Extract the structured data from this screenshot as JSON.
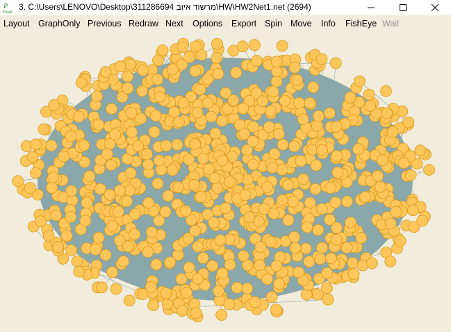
{
  "window": {
    "title": "3. C:\\Users\\LENOVO\\Desktop\\311286694 מרשוד איוב\\HW\\HW2Net1.net (2694)",
    "icon_name": "pajek-app-icon",
    "controls": [
      "minimize-icon",
      "maximize-icon",
      "close-icon"
    ]
  },
  "menu": [
    {
      "label": "Layout",
      "enabled": true
    },
    {
      "label": "GraphOnly",
      "enabled": true
    },
    {
      "label": "Previous",
      "enabled": true
    },
    {
      "label": "Redraw",
      "enabled": true
    },
    {
      "label": "Next",
      "enabled": true
    },
    {
      "label": "Options",
      "enabled": true
    },
    {
      "label": "Export",
      "enabled": true
    },
    {
      "label": "Spin",
      "enabled": true
    },
    {
      "label": "Move",
      "enabled": true
    },
    {
      "label": "Info",
      "enabled": true
    },
    {
      "label": "FishEye",
      "enabled": true
    },
    {
      "label": "Wait",
      "enabled": false
    }
  ],
  "graph": {
    "vertex_count": 2694,
    "vertex_fill": "#fcc65a",
    "vertex_stroke": "#d99a1c",
    "edge_color": "#8aa7aa",
    "background": "#f1ecdc"
  }
}
